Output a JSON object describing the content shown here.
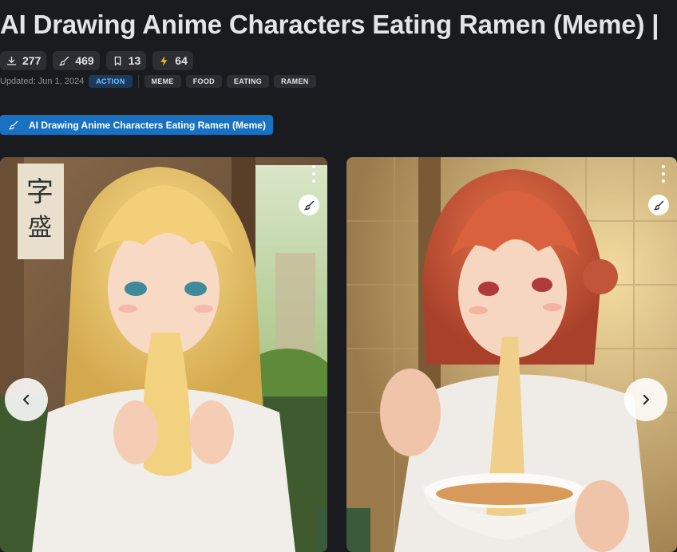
{
  "page": {
    "title": "AI Drawing Anime Characters Eating Ramen (Meme) |"
  },
  "stats": {
    "downloads": "277",
    "generations": "469",
    "bookmarks": "13",
    "buzz": "64"
  },
  "meta": {
    "updated": "Updated: Jun 1, 2024",
    "category": "ACTION",
    "tags": [
      "MEME",
      "FOOD",
      "EATING",
      "RAMEN"
    ]
  },
  "collection": {
    "label": "AI Drawing Anime Characters Eating Ramen (Meme)"
  },
  "gallery": {
    "images": [
      {
        "subject": "blonde anime girl eating ramen noodles"
      },
      {
        "subject": "red-haired anime girl eating ramen noodles from a bowl"
      }
    ]
  },
  "icons": {
    "download": "download-icon",
    "generations": "brush-icon",
    "bookmark": "bookmark-icon",
    "buzz": "lightning-icon",
    "collection": "brush-icon",
    "more": "more-dots-icon",
    "remix": "brush-icon",
    "prev": "chevron-left-icon",
    "next": "chevron-right-icon"
  },
  "colors": {
    "background": "#1a1b1e",
    "accent": "#1971c2",
    "buzz": "#fab005",
    "action_badge": "#74c0fc"
  }
}
